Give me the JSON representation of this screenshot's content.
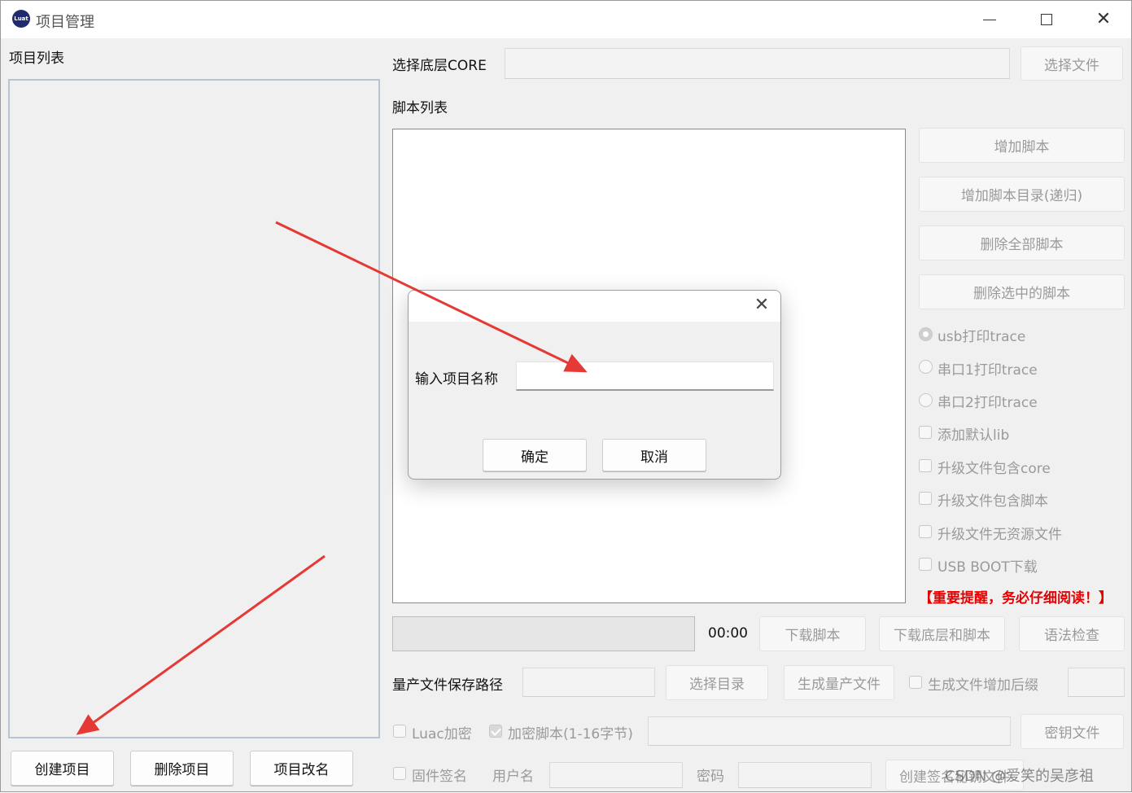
{
  "window": {
    "title": "项目管理",
    "app_icon_text": "Luat",
    "minimize": "—",
    "maximize": "□",
    "close": "✕"
  },
  "left": {
    "project_list_label": "项目列表",
    "create_button": "创建项目",
    "delete_button": "删除项目",
    "rename_button": "项目改名"
  },
  "core": {
    "label": "选择底层CORE",
    "value": "",
    "select_button": "选择文件"
  },
  "scripts": {
    "label": "脚本列表",
    "add_script": "增加脚本",
    "add_script_dir": "增加脚本目录(递归)",
    "delete_all": "删除全部脚本",
    "delete_selected": "删除选中的脚本"
  },
  "options": {
    "radios": [
      {
        "label": "usb打印trace",
        "checked": true
      },
      {
        "label": "串口1打印trace",
        "checked": false
      },
      {
        "label": "串口2打印trace",
        "checked": false
      }
    ],
    "checks": [
      {
        "label": "添加默认lib",
        "checked": false
      },
      {
        "label": "升级文件包含core",
        "checked": false
      },
      {
        "label": "升级文件包含脚本",
        "checked": false
      },
      {
        "label": "升级文件无资源文件",
        "checked": false
      },
      {
        "label": "USB BOOT下载",
        "checked": false
      }
    ],
    "warning": "【重要提醒，务必仔细阅读！】"
  },
  "download": {
    "progress": 0,
    "time": "00:00",
    "download_script": "下载脚本",
    "download_core_script": "下载底层和脚本",
    "syntax_check": "语法检查"
  },
  "production": {
    "path_label": "量产文件保存路径",
    "path_value": "",
    "select_dir": "选择目录",
    "generate": "生成量产文件",
    "add_suffix_label": "生成文件增加后缀",
    "add_suffix_checked": false
  },
  "encrypt": {
    "luac_label": "Luac加密",
    "luac_checked": false,
    "encrypt_script_label": "加密脚本(1-16字节)",
    "encrypt_script_checked": true,
    "key_button": "密钥文件"
  },
  "sign": {
    "firmware_sign_label": "固件签名",
    "firmware_sign_checked": false,
    "username_label": "用户名",
    "password_label": "密码",
    "create_sign_button": "创建签名秘钥文件"
  },
  "dialog": {
    "prompt": "输入项目名称",
    "input_value": "",
    "ok": "确定",
    "cancel": "取消",
    "close": "✕"
  },
  "watermark": "CSDN @爱笑的吴彦祖"
}
